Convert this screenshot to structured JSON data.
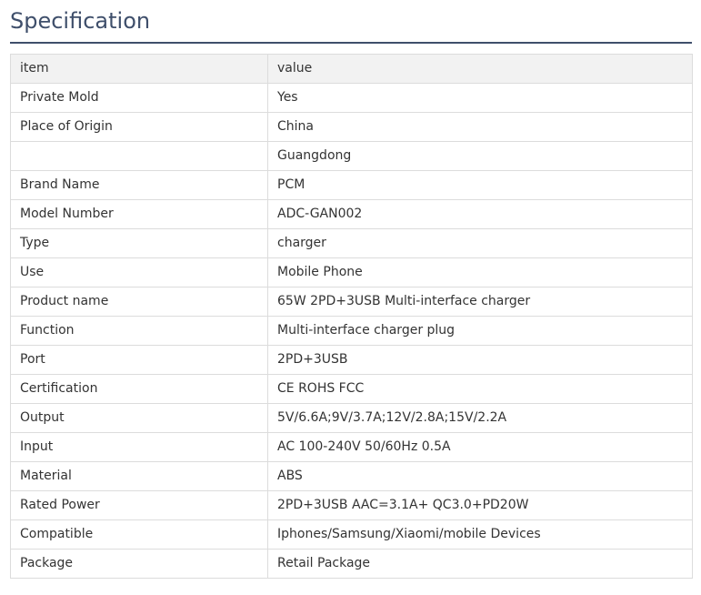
{
  "section": {
    "title": "Specification"
  },
  "table": {
    "header": {
      "item": "item",
      "value": "value"
    },
    "rows": [
      {
        "item": "Private Mold",
        "value": "Yes"
      },
      {
        "item": "Place of Origin",
        "value": "China"
      },
      {
        "item": "",
        "value": "Guangdong"
      },
      {
        "item": "Brand Name",
        "value": "PCM"
      },
      {
        "item": "Model Number",
        "value": "ADC-GAN002"
      },
      {
        "item": "Type",
        "value": "charger"
      },
      {
        "item": "Use",
        "value": "Mobile Phone"
      },
      {
        "item": "Product name",
        "value": "65W 2PD+3USB Multi-interface charger"
      },
      {
        "item": "Function",
        "value": "Multi-interface charger plug"
      },
      {
        "item": "Port",
        "value": "2PD+3USB"
      },
      {
        "item": "Certification",
        "value": "CE ROHS FCC"
      },
      {
        "item": "Output",
        "value": "5V/6.6A;9V/3.7A;12V/2.8A;15V/2.2A"
      },
      {
        "item": "Input",
        "value": "AC 100-240V 50/60Hz 0.5A"
      },
      {
        "item": "Material",
        "value": "ABS"
      },
      {
        "item": "Rated Power",
        "value": "2PD+3USB AAC=3.1A+ QC3.0+PD20W"
      },
      {
        "item": "Compatible",
        "value": "Iphones/Samsung/Xiaomi/mobile Devices"
      },
      {
        "item": "Package",
        "value": "Retail Package"
      }
    ]
  }
}
